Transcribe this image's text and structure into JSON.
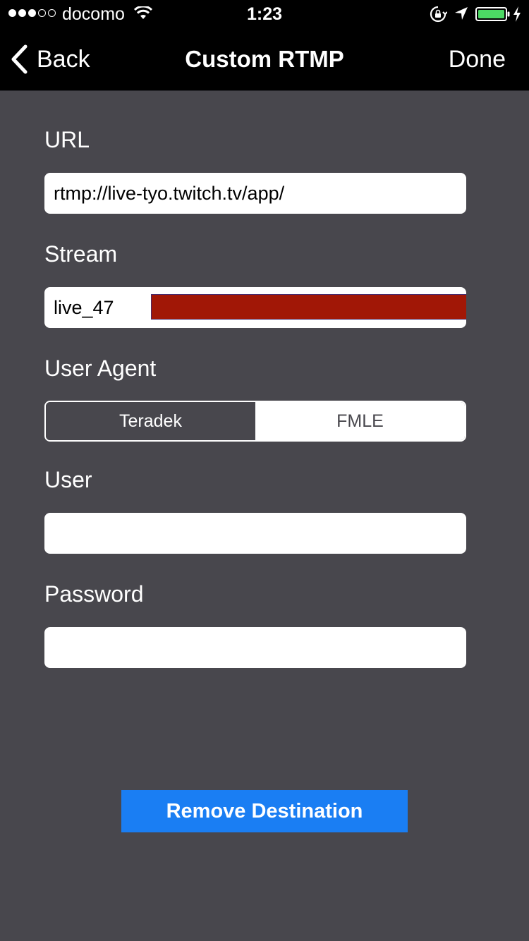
{
  "status_bar": {
    "carrier": "docomo",
    "time": "1:23",
    "signal_bars_filled": 3,
    "signal_bars_total": 5,
    "battery_color": "#4cd964"
  },
  "nav": {
    "back_label": "Back",
    "title": "Custom RTMP",
    "done_label": "Done"
  },
  "form": {
    "url_label": "URL",
    "url_value": "rtmp://live-tyo.twitch.tv/app/",
    "stream_label": "Stream",
    "stream_value": "live_47",
    "user_agent_label": "User Agent",
    "user_agent_options": [
      "Teradek",
      "FMLE"
    ],
    "user_agent_selected": "Teradek",
    "user_label": "User",
    "user_value": "",
    "password_label": "Password",
    "password_value": ""
  },
  "actions": {
    "remove_label": "Remove Destination",
    "remove_color": "#1a7ef3"
  },
  "colors": {
    "background": "#48474d",
    "bar": "#000000",
    "redaction": "#a11706"
  }
}
